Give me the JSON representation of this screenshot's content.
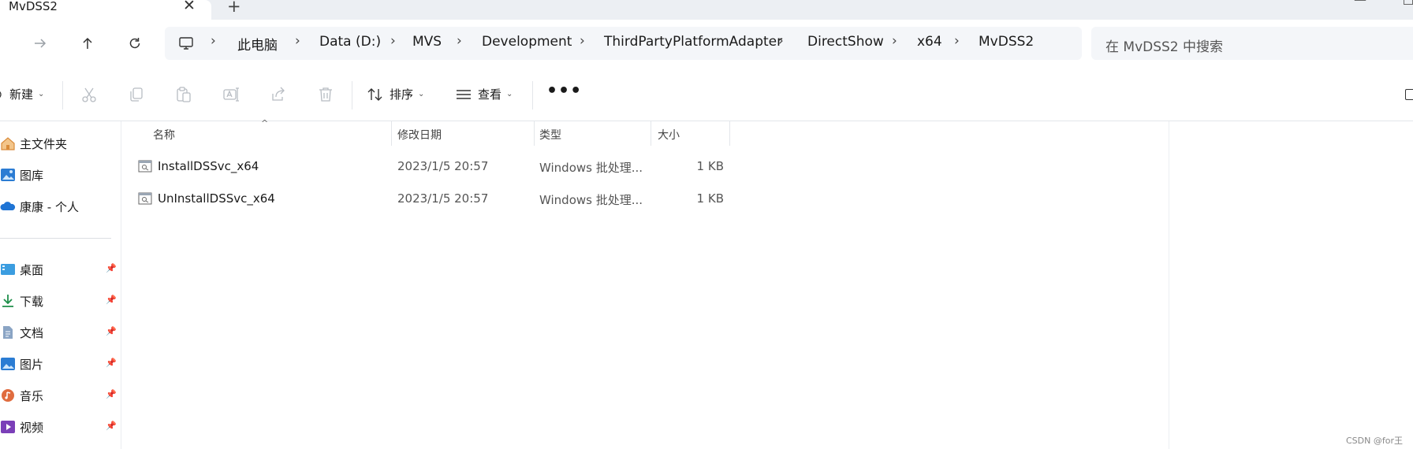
{
  "window": {
    "tab_title": "MvDSS2",
    "tab_close_glyph": "✕",
    "new_tab_glyph": "+",
    "minimize_glyph": "—"
  },
  "address": {
    "crumbs": [
      "此电脑",
      "Data (D:)",
      "MVS",
      "Development",
      "ThirdPartyPlatformAdapter",
      "DirectShow",
      "x64",
      "MvDSS2"
    ],
    "separator": "›",
    "search_placeholder": "在 MvDSS2 中搜索"
  },
  "nav": {
    "forward_icon": "arrow-right-icon",
    "up_icon": "arrow-up-icon",
    "refresh_icon": "refresh-icon"
  },
  "commands": {
    "new_label": "新建",
    "sort_label": "排序",
    "view_label": "查看",
    "more_glyph": "•••",
    "chevron_glyph": "⌄",
    "icons": [
      "cut-icon",
      "copy-icon",
      "paste-icon",
      "rename-icon",
      "share-icon",
      "delete-icon"
    ]
  },
  "sidebar": {
    "top_items": [
      {
        "label": "主文件夹",
        "icon": "home-icon"
      },
      {
        "label": "图库",
        "icon": "gallery-icon"
      },
      {
        "label": "康康 - 个人",
        "icon": "cloud-icon"
      }
    ],
    "pinned_items": [
      {
        "label": "桌面",
        "icon": "desktop-icon"
      },
      {
        "label": "下载",
        "icon": "download-icon"
      },
      {
        "label": "文档",
        "icon": "document-icon"
      },
      {
        "label": "图片",
        "icon": "pictures-icon"
      },
      {
        "label": "音乐",
        "icon": "music-icon"
      },
      {
        "label": "视频",
        "icon": "video-icon"
      }
    ],
    "pin_glyph": "📌"
  },
  "columns": {
    "name": "名称",
    "date": "修改日期",
    "type": "类型",
    "size": "大小",
    "sort_glyph": "^"
  },
  "files": [
    {
      "name": "InstallDSSvc_x64",
      "date": "2023/1/5 20:57",
      "type": "Windows 批处理...",
      "size": "1 KB"
    },
    {
      "name": "UnInstallDSSvc_x64",
      "date": "2023/1/5 20:57",
      "type": "Windows 批处理...",
      "size": "1 KB"
    }
  ],
  "watermark": "CSDN @for王",
  "colors": {
    "accent_blue": "#2b7cd3",
    "home_orange": "#e8a25c",
    "download_green": "#1e8f4a",
    "music_orange": "#e06c3f",
    "video_purple": "#7b3fb8"
  }
}
